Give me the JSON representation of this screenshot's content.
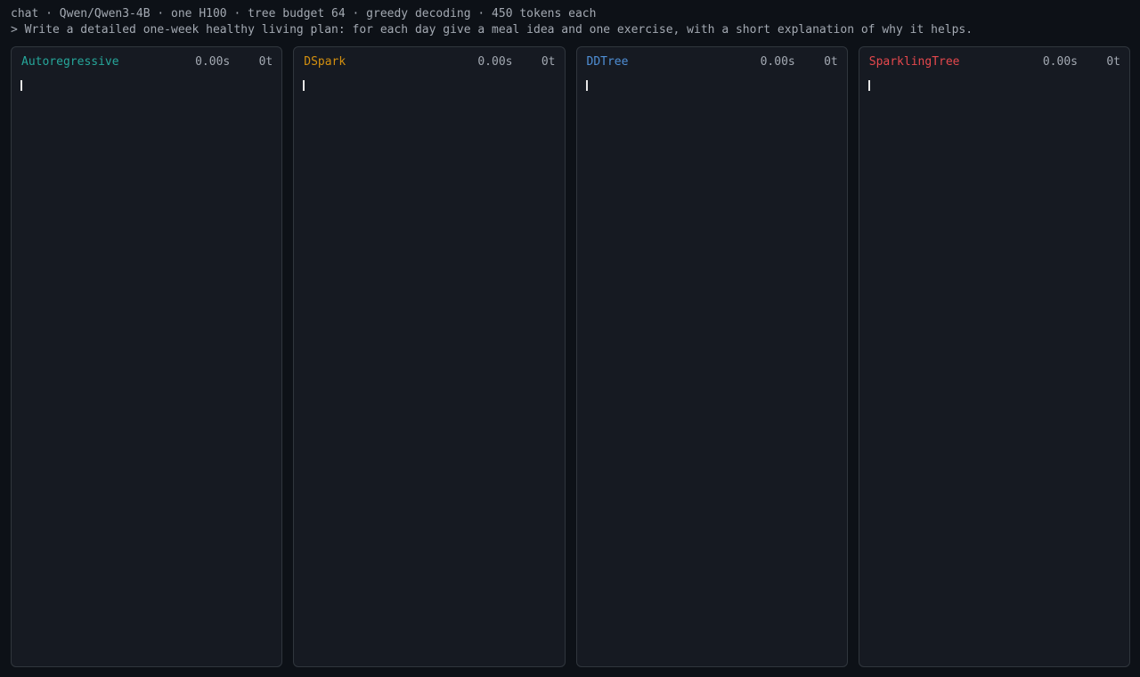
{
  "header": {
    "info_line": "chat · Qwen/Qwen3-4B · one H100 · tree budget 64 · greedy decoding · 450 tokens each",
    "prompt_line": "> Write a detailed one-week healthy living plan: for each day give a meal idea and one exercise, with a short explanation of why it helps."
  },
  "panels": [
    {
      "title": "Autoregressive",
      "time": "0.00s",
      "tokens": "0t",
      "color": "#26a69a"
    },
    {
      "title": "DSpark",
      "time": "0.00s",
      "tokens": "0t",
      "color": "#d4900f"
    },
    {
      "title": "DDTree",
      "time": "0.00s",
      "tokens": "0t",
      "color": "#4f8fd6"
    },
    {
      "title": "SparklingTree",
      "time": "0.00s",
      "tokens": "0t",
      "color": "#e5484d"
    }
  ]
}
